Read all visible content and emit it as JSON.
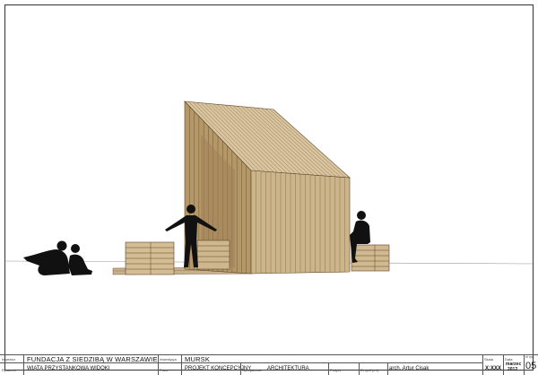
{
  "title_block": {
    "investor_label": "Inwestor",
    "investor_value": "FUNDACJA Z SIEDZIBĄ W WARSZAWIE",
    "drawing_label": "Rysunek",
    "drawing_value": "WIATA PRZYSTANKOWA WIDOKI",
    "investment_label": "Inwestycja",
    "investment_value": "MURSK",
    "phase_label": "Faza",
    "phase_value": "PROJEKT KONCEPCYJNY",
    "discipline_label": "Specjalność",
    "discipline_value": "ARCHITEKTURA",
    "signature_label": "Podpis",
    "author_label": "Zespół proj.",
    "author_value": "arch. Artur Cisak",
    "scale_label": "Skala",
    "scale_value": "X:XXX",
    "date_label": "Data",
    "date_value_month": "marzec",
    "date_value_year": "2012",
    "sheet_label": "nr rys.",
    "sheet_value": "05"
  },
  "colors": {
    "wood_light": "#d8c39d",
    "wood_mid": "#b89b6e",
    "wood_dark": "#8a6f4b",
    "silhouette": "#111111",
    "line": "#333333"
  }
}
